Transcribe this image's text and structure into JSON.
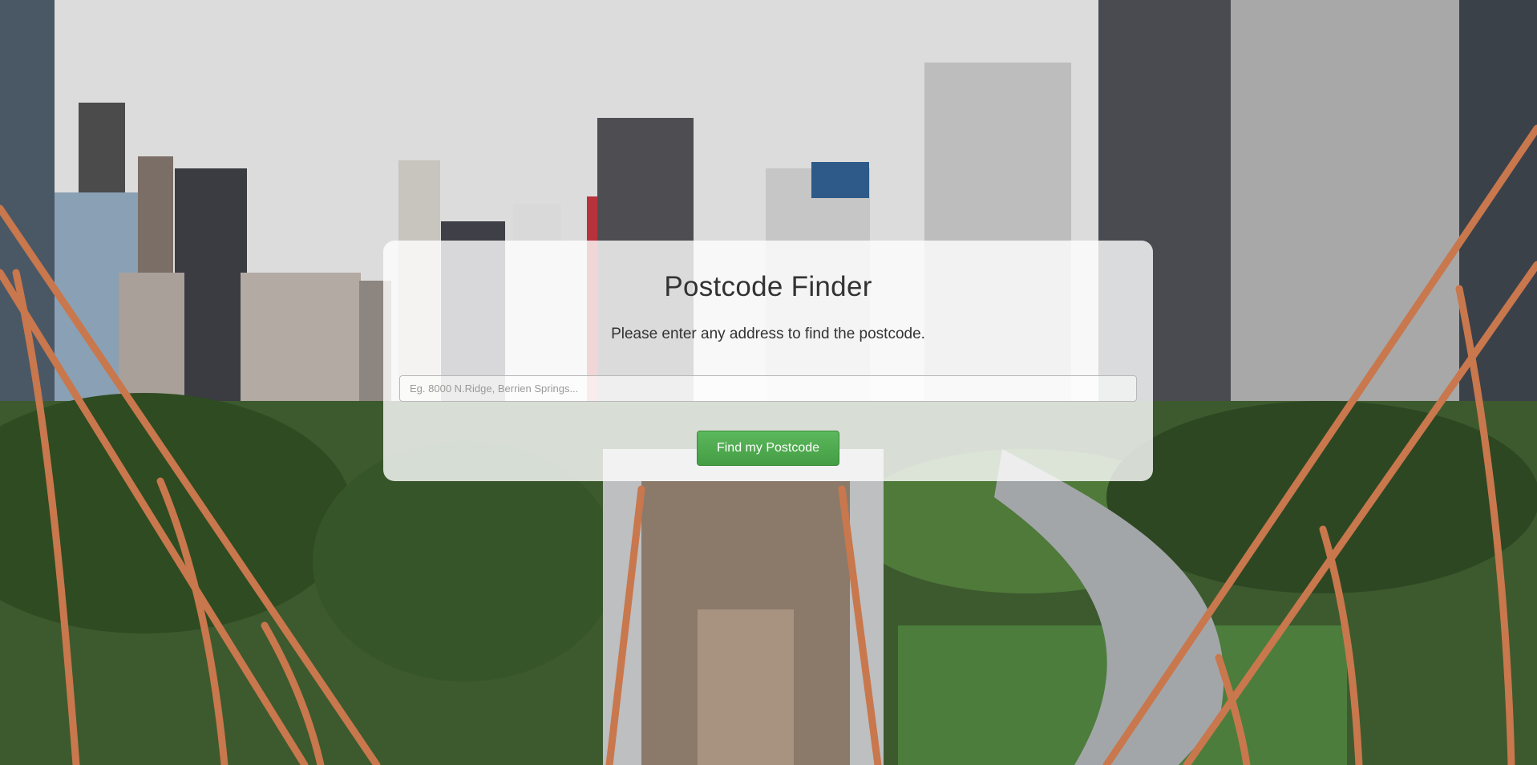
{
  "header": {
    "title": "Postcode Finder",
    "subtitle": "Please enter any address to find the postcode."
  },
  "search": {
    "placeholder": "Eg. 8000 N.Ridge, Berrien Springs...",
    "value": ""
  },
  "actions": {
    "find_label": "Find my Postcode"
  },
  "colors": {
    "button_green": "#5cb85c",
    "card_background": "#ffffff",
    "text": "#333333"
  }
}
